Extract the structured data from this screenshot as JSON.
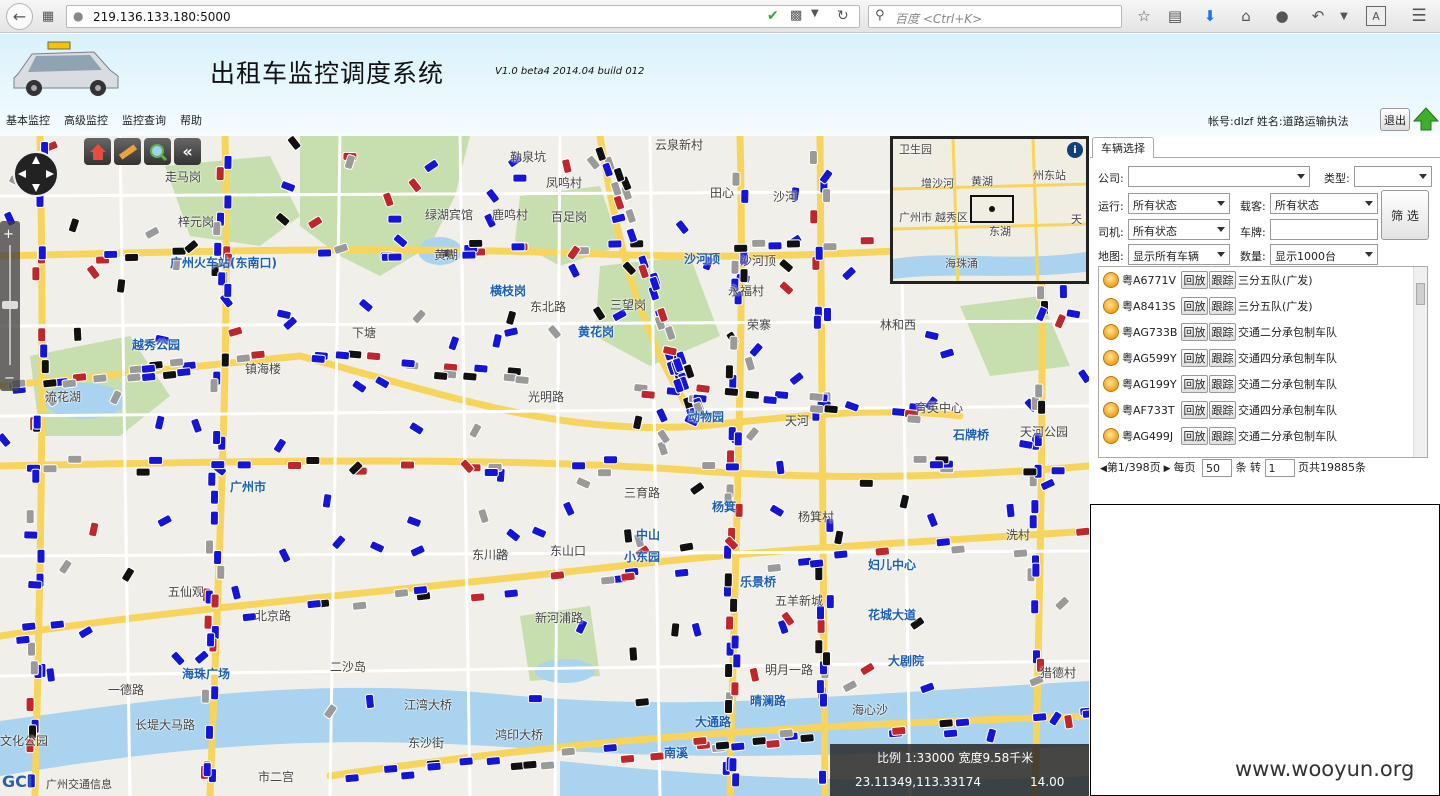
{
  "browser": {
    "url": "219.136.133.180:5000",
    "search_placeholder": "百度 <Ctrl+K>"
  },
  "header": {
    "title": "出租车监控调度系统",
    "version": "V1.0 beta4 2014.04 build 012",
    "menu": [
      "基本监控",
      "高级监控",
      "监控查询",
      "帮助"
    ],
    "account": "帐号:dlzf 姓名:道路运输执法",
    "logout": "退出"
  },
  "map": {
    "labels": [
      "勒泉坑",
      "云泉新村",
      "走马岗",
      "梓元岗",
      "凤鸣村",
      "百足岗",
      "鹿鸣村",
      "绿湖宾馆",
      "田心",
      "沙河",
      "广州火车站(东南口)",
      "黄湖",
      "横枝岗",
      "三望岗",
      "沙河顶",
      "永福村",
      "沙河顶",
      "越秀公园",
      "流花湖",
      "下塘",
      "东北路",
      "黄花岗",
      "荣寨",
      "林和西",
      "镇海楼",
      "光明路",
      "动物园",
      "天河",
      "育英中心",
      "石牌桥",
      "广州市",
      "三育路",
      "杨箕",
      "中山",
      "东山口",
      "小东园",
      "杨箕村",
      "五仙观",
      "北京路",
      "东川路",
      "新河浦路",
      "乐景桥",
      "五羊新城",
      "妇儿中心",
      "花城大道",
      "海珠广场",
      "二沙岛",
      "大剧院",
      "一德路",
      "江湾大桥",
      "晴澜路",
      "明月一路",
      "猎德村",
      "大通路",
      "文化公园",
      "东沙街",
      "南溪",
      "海心沙",
      "鸿印大桥",
      "长堤大马路",
      "市二宫",
      "洗村",
      "天河公园"
    ],
    "overview_labels": [
      "卫生园",
      "黄湖",
      "增沙河",
      "广州市",
      "越秀区",
      "东湖",
      "海珠涌",
      "州东站",
      "天"
    ],
    "overview_info": "i",
    "scale": "比例 1:33000 宽度9.58千米",
    "coords": "23.11349,113.33174",
    "zoom": "14.00",
    "logo": "GCI",
    "logo_sub": "广州交通信息"
  },
  "panel": {
    "tab": "车辆选择",
    "company_label": "公司:",
    "company_value": "",
    "type_label": "类型:",
    "type_value": "",
    "run_label": "运行:",
    "run_value": "所有状态",
    "load_label": "载客:",
    "load_value": "所有状态",
    "filter_button": "筛 选",
    "driver_label": "司机:",
    "driver_value": "所有状态",
    "plate_label": "车牌:",
    "plate_value": "",
    "mapmode_label": "地图:",
    "mapmode_value": "显示所有车辆",
    "count_label": "数量:",
    "count_value": "显示1000台",
    "replay_label": "回放",
    "track_label": "跟踪",
    "vehicles": [
      {
        "plate": "粤A6771V",
        "team": "三分五队(广发)"
      },
      {
        "plate": "粤A8413S",
        "team": "三分五队(广发)"
      },
      {
        "plate": "粤AG733B",
        "team": "交通二分承包制车队"
      },
      {
        "plate": "粤AG599Y",
        "team": "交通四分承包制车队"
      },
      {
        "plate": "粤AG199Y",
        "team": "交通二分承包制车队"
      },
      {
        "plate": "粤AF733T",
        "team": "交通四分承包制车队"
      },
      {
        "plate": "粤AG499J",
        "team": "交通二分承包制车队"
      }
    ],
    "pager": {
      "page_info": "第1/398页",
      "per_page_label": "每页",
      "per_page": "50",
      "unit_label": "条 转",
      "goto_page": "1",
      "total": "页共19885条"
    },
    "watermark": "www.wooyun.org"
  },
  "colors": {
    "taxi_blue": "#1515d8",
    "taxi_red": "#c0272d",
    "taxi_black": "#111111",
    "taxi_gray": "#9a9a9a"
  }
}
